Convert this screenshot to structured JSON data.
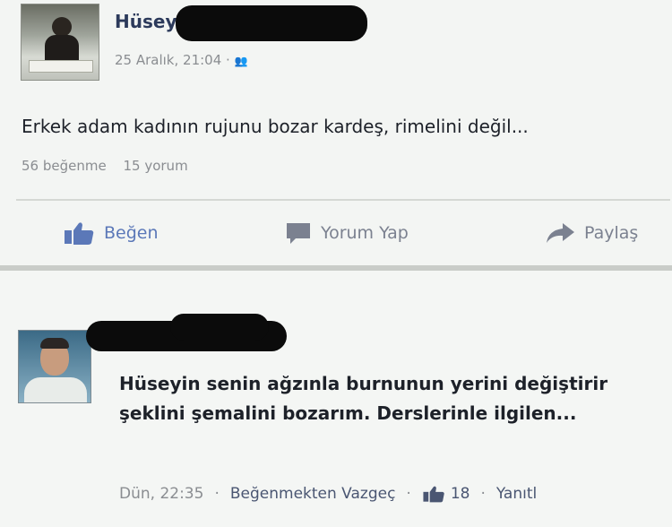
{
  "post": {
    "author": "Hüseyi",
    "timestamp": "25 Aralık, 21:04",
    "privacy_icon": "friends-icon",
    "text": "Erkek adam kadının rujunu bozar kardeş, rimelini değil...",
    "likes": "56 beğenme",
    "comments": "15 yorum",
    "actions": {
      "like": "Beğen",
      "comment": "Yorum Yap",
      "share": "Paylaş"
    }
  },
  "comment": {
    "text": "Hüseyin senin ağzınla burnunun yerini değiştirir şeklini şemalini bozarım. Derslerinle ilgilen...",
    "timestamp": "Dün, 22:35",
    "unlike_label": "Beğenmekten Vazgeç",
    "like_count": "18",
    "reply_label": "Yanıtl"
  },
  "colors": {
    "accent": "#5b78b8",
    "muted": "#8a8d91"
  }
}
